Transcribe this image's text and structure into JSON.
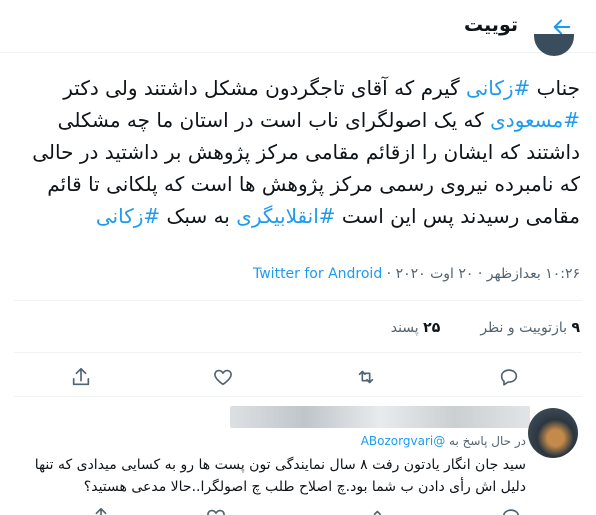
{
  "header": {
    "title": "توییت"
  },
  "tweet": {
    "segments": [
      {
        "text": "جناب ",
        "hashtag": false
      },
      {
        "text": "#زکانی",
        "hashtag": true
      },
      {
        "text": " گیرم که آقای تاجگردون مشکل داشتند ولی دکتر ",
        "hashtag": false
      },
      {
        "text": "#مسعودی",
        "hashtag": true
      },
      {
        "text": " که یک اصولگرای ناب است در استان ما چه مشکلی داشتند که ایشان را ازقائم مقامی مرکز پژوهش بر داشتید در حالی که نامبرده نیروی رسمی مرکز پژوهش ها است که پلکانی تا قائم مقامی رسیدند پس این است ",
        "hashtag": false
      },
      {
        "text": "#انقلابیگری",
        "hashtag": true
      },
      {
        "text": " به سبک  ",
        "hashtag": false
      },
      {
        "text": "#زکانی",
        "hashtag": true
      }
    ],
    "time": "۱۰:۲۶ بعدازظهر",
    "date": "۲۰ اوت ۲۰۲۰",
    "separator": "·",
    "source": "Twitter for Android"
  },
  "stats": {
    "retweets_count": "۹",
    "retweets_label": "بازتوییت و نظر",
    "likes_count": "۲۵",
    "likes_label": "پسند"
  },
  "reply": {
    "replying_prefix": "در حال پاسخ به",
    "mention": "@ABozorgvari",
    "text": "سید جان انگار یادتون رفت ۸ سال نمایندگی تون پست ها رو به کسایی میدادی که تنها دلیل اش رأی دادن ب شما بود.چ اصلاح طلب چ اصولگرا..حالا مدعی هستید؟"
  },
  "icons": {
    "back": "arrow-left-icon",
    "reply": "comment-icon",
    "retweet": "retweet-icon",
    "like": "heart-icon",
    "share": "share-icon"
  },
  "colors": {
    "accent": "#1d9bf0",
    "text": "#0f1419",
    "muted": "#536471",
    "border": "#eff3f4"
  }
}
